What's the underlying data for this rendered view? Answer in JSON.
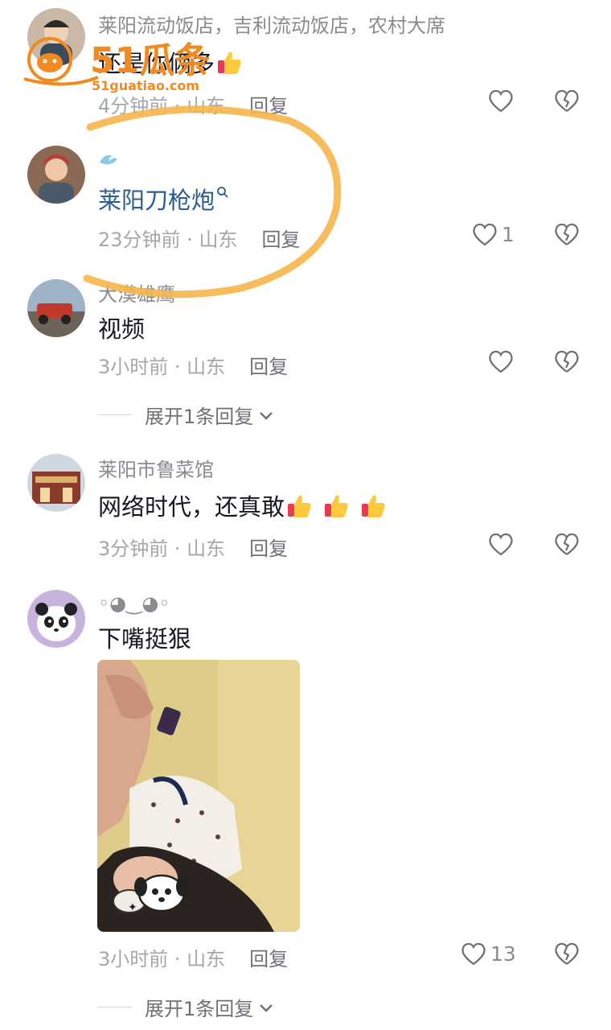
{
  "comments": [
    {
      "username": "莱阳流动饭店，吉利流动饭店，农村大席",
      "content": "还是你俩多",
      "time": "4分钟前",
      "location": "山东",
      "reply_label": "回复",
      "likes": ""
    },
    {
      "username": "",
      "content": "莱阳刀枪炮",
      "time": "23分钟前",
      "location": "山东",
      "reply_label": "回复",
      "likes": "1"
    },
    {
      "username": "大漠雄鹰",
      "content": "视频",
      "time": "3小时前",
      "location": "山东",
      "reply_label": "回复",
      "likes": "",
      "expand_label": "展开1条回复"
    },
    {
      "username": "莱阳市鲁菜馆",
      "content": "网络时代，还真敢",
      "time": "3分钟前",
      "location": "山东",
      "reply_label": "回复",
      "likes": ""
    },
    {
      "username": "◦◕‿◕◦",
      "content": "下嘴挺狠",
      "time": "3小时前",
      "location": "山东",
      "reply_label": "回复",
      "likes": "13",
      "expand_label": "展开1条回复"
    }
  ],
  "watermark": {
    "brand": "51瓜条",
    "url": "51guatiao.com"
  },
  "colors": {
    "annotation_circle": "#f6b54a",
    "link": "#2b5d8e",
    "watermark": "#f28a22"
  },
  "icons": [
    "heart-outline-icon",
    "broken-heart-icon",
    "thumbs-up-emoji",
    "search-icon",
    "chevron-down-icon"
  ]
}
